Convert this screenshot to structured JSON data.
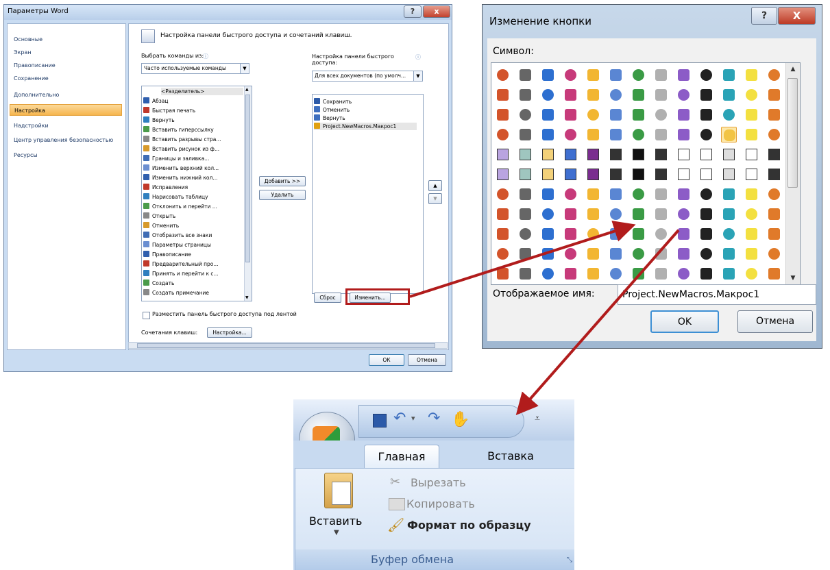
{
  "word_options": {
    "title": "Параметры Word",
    "help": "?",
    "close": "x",
    "nav": [
      "Основные",
      "Экран",
      "Правописание",
      "Сохранение",
      "Дополнительно",
      "Настройка",
      "Надстройки",
      "Центр управления безопасностью",
      "Ресурсы"
    ],
    "selected_nav": "Настройка",
    "header": "Настройка панели быстрого доступа и сочетаний клавиш.",
    "choose_label": "Выбрать команды из:",
    "choose_value": "Часто используемые команды",
    "qat_label": "Настройка панели быстрого доступа:",
    "qat_value": "Для всех документов (по умолч...",
    "commands": [
      "<Разделитель>",
      "Абзац",
      "Быстрая печать",
      "Вернуть",
      "Вставить гиперссылку",
      "Вставить разрывы стра...",
      "Вставить рисунок из ф...",
      "Границы и заливка...",
      "Изменить верхний кол...",
      "Изменить нижний кол...",
      "Исправления",
      "Нарисовать таблицу",
      "Отклонить и перейти ...",
      "Открыть",
      "Отменить",
      "Отобразить все знаки",
      "Параметры страницы",
      "Правописание",
      "Предварительный про...",
      "Принять и перейти к с...",
      "Создать",
      "Создать примечание"
    ],
    "qat_items": [
      "Сохранить",
      "Отменить",
      "Вернуть",
      "Project.NewMacros.Макрос1"
    ],
    "add_button": "Добавить >>",
    "remove_button": "Удалить",
    "reset_button": "Сброс",
    "modify_button": "Изменить...",
    "below_ribbon": "Разместить панель быстрого доступа под лентой",
    "shortcuts_label": "Сочетания клавиш:",
    "shortcuts_button": "Настройка...",
    "ok": "ОК",
    "cancel": "Отмена"
  },
  "button_change": {
    "title": "Изменение кнопки",
    "help": "?",
    "close": "X",
    "symbol_label": "Символ:",
    "display_name_label": "Отображаемое имя:",
    "display_name_value": "Project.NewMacros.Макрос1",
    "ok": "OK",
    "cancel": "Отмена",
    "selected_index": 49
  },
  "ribbon": {
    "tabs": [
      "Главная",
      "Вставка"
    ],
    "paste": "Вставить",
    "cut": "Вырезать",
    "copy": "Копировать",
    "format_painter": "Формат по образцу",
    "group": "Буфер обмена"
  }
}
